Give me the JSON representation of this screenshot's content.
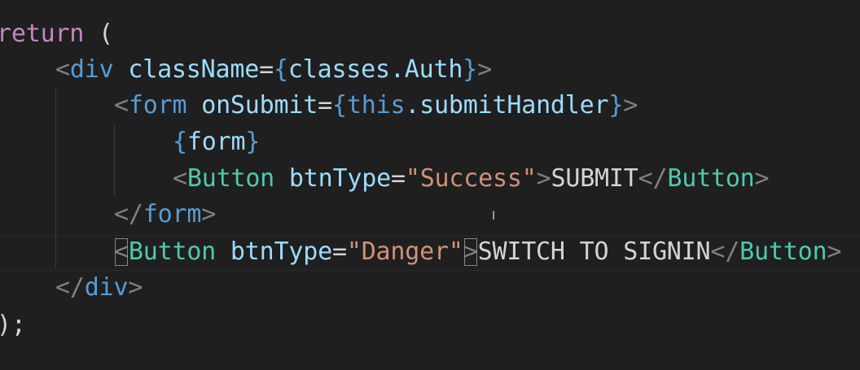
{
  "code": {
    "line1": {
      "keyword": "return",
      "rest": " ("
    },
    "line2": {
      "open": "<",
      "tag": "div",
      "sp": " ",
      "attr": "className",
      "eq": "=",
      "brace_open": "{",
      "expr": "classes.Auth",
      "brace_close": "}",
      "close": ">"
    },
    "line3": {
      "open": "<",
      "tag": "form",
      "sp": " ",
      "attr": "onSubmit",
      "eq": "=",
      "brace_open": "{",
      "this": "this",
      "expr": ".submitHandler",
      "brace_close": "}",
      "close": ">"
    },
    "line4": {
      "brace_open": "{",
      "expr": "form",
      "brace_close": "}"
    },
    "line5": {
      "open": "<",
      "tag": "Button",
      "sp": " ",
      "attr": "btnType",
      "eq": "=",
      "value": "\"Success\"",
      "close": ">",
      "text": "SUBMIT",
      "end_open": "</",
      "end_tag": "Button",
      "end_close": ">"
    },
    "line6": {
      "open": "</",
      "tag": "form",
      "close": ">"
    },
    "line7": {
      "open": "<",
      "tag": "Button",
      "sp": " ",
      "attr": "btnType",
      "eq": "=",
      "value": "\"Danger\"",
      "close": ">",
      "text": "SWITCH TO SIGNIN",
      "end_open": "</",
      "end_tag": "Button",
      "end_close": ">"
    },
    "line8": {
      "open": "</",
      "tag": "div",
      "close": ">"
    },
    "line9": {
      "text": ");"
    }
  },
  "cursor": {
    "glyph": "I"
  },
  "colors": {
    "background": "#1f1f1f",
    "keyword": "#c586c0",
    "tag": "#569cd6",
    "component": "#4ec9b0",
    "attribute": "#9cdcfe",
    "string": "#ce9178",
    "text": "#d4d4d4",
    "bracket": "#808080"
  }
}
